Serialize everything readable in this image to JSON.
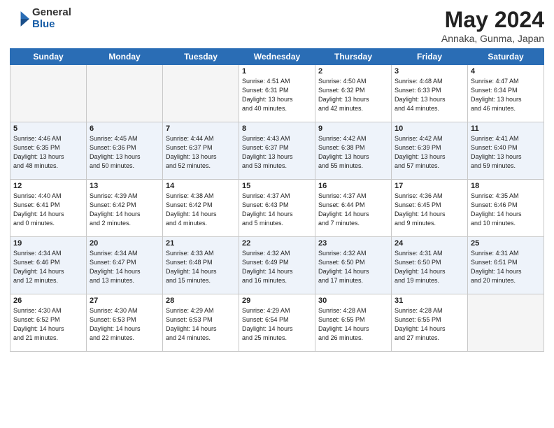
{
  "logo": {
    "general": "General",
    "blue": "Blue"
  },
  "title": {
    "month": "May 2024",
    "location": "Annaka, Gunma, Japan"
  },
  "weekdays": [
    "Sunday",
    "Monday",
    "Tuesday",
    "Wednesday",
    "Thursday",
    "Friday",
    "Saturday"
  ],
  "weeks": [
    [
      {
        "day": "",
        "info": ""
      },
      {
        "day": "",
        "info": ""
      },
      {
        "day": "",
        "info": ""
      },
      {
        "day": "1",
        "info": "Sunrise: 4:51 AM\nSunset: 6:31 PM\nDaylight: 13 hours\nand 40 minutes."
      },
      {
        "day": "2",
        "info": "Sunrise: 4:50 AM\nSunset: 6:32 PM\nDaylight: 13 hours\nand 42 minutes."
      },
      {
        "day": "3",
        "info": "Sunrise: 4:48 AM\nSunset: 6:33 PM\nDaylight: 13 hours\nand 44 minutes."
      },
      {
        "day": "4",
        "info": "Sunrise: 4:47 AM\nSunset: 6:34 PM\nDaylight: 13 hours\nand 46 minutes."
      }
    ],
    [
      {
        "day": "5",
        "info": "Sunrise: 4:46 AM\nSunset: 6:35 PM\nDaylight: 13 hours\nand 48 minutes."
      },
      {
        "day": "6",
        "info": "Sunrise: 4:45 AM\nSunset: 6:36 PM\nDaylight: 13 hours\nand 50 minutes."
      },
      {
        "day": "7",
        "info": "Sunrise: 4:44 AM\nSunset: 6:37 PM\nDaylight: 13 hours\nand 52 minutes."
      },
      {
        "day": "8",
        "info": "Sunrise: 4:43 AM\nSunset: 6:37 PM\nDaylight: 13 hours\nand 53 minutes."
      },
      {
        "day": "9",
        "info": "Sunrise: 4:42 AM\nSunset: 6:38 PM\nDaylight: 13 hours\nand 55 minutes."
      },
      {
        "day": "10",
        "info": "Sunrise: 4:42 AM\nSunset: 6:39 PM\nDaylight: 13 hours\nand 57 minutes."
      },
      {
        "day": "11",
        "info": "Sunrise: 4:41 AM\nSunset: 6:40 PM\nDaylight: 13 hours\nand 59 minutes."
      }
    ],
    [
      {
        "day": "12",
        "info": "Sunrise: 4:40 AM\nSunset: 6:41 PM\nDaylight: 14 hours\nand 0 minutes."
      },
      {
        "day": "13",
        "info": "Sunrise: 4:39 AM\nSunset: 6:42 PM\nDaylight: 14 hours\nand 2 minutes."
      },
      {
        "day": "14",
        "info": "Sunrise: 4:38 AM\nSunset: 6:42 PM\nDaylight: 14 hours\nand 4 minutes."
      },
      {
        "day": "15",
        "info": "Sunrise: 4:37 AM\nSunset: 6:43 PM\nDaylight: 14 hours\nand 5 minutes."
      },
      {
        "day": "16",
        "info": "Sunrise: 4:37 AM\nSunset: 6:44 PM\nDaylight: 14 hours\nand 7 minutes."
      },
      {
        "day": "17",
        "info": "Sunrise: 4:36 AM\nSunset: 6:45 PM\nDaylight: 14 hours\nand 9 minutes."
      },
      {
        "day": "18",
        "info": "Sunrise: 4:35 AM\nSunset: 6:46 PM\nDaylight: 14 hours\nand 10 minutes."
      }
    ],
    [
      {
        "day": "19",
        "info": "Sunrise: 4:34 AM\nSunset: 6:46 PM\nDaylight: 14 hours\nand 12 minutes."
      },
      {
        "day": "20",
        "info": "Sunrise: 4:34 AM\nSunset: 6:47 PM\nDaylight: 14 hours\nand 13 minutes."
      },
      {
        "day": "21",
        "info": "Sunrise: 4:33 AM\nSunset: 6:48 PM\nDaylight: 14 hours\nand 15 minutes."
      },
      {
        "day": "22",
        "info": "Sunrise: 4:32 AM\nSunset: 6:49 PM\nDaylight: 14 hours\nand 16 minutes."
      },
      {
        "day": "23",
        "info": "Sunrise: 4:32 AM\nSunset: 6:50 PM\nDaylight: 14 hours\nand 17 minutes."
      },
      {
        "day": "24",
        "info": "Sunrise: 4:31 AM\nSunset: 6:50 PM\nDaylight: 14 hours\nand 19 minutes."
      },
      {
        "day": "25",
        "info": "Sunrise: 4:31 AM\nSunset: 6:51 PM\nDaylight: 14 hours\nand 20 minutes."
      }
    ],
    [
      {
        "day": "26",
        "info": "Sunrise: 4:30 AM\nSunset: 6:52 PM\nDaylight: 14 hours\nand 21 minutes."
      },
      {
        "day": "27",
        "info": "Sunrise: 4:30 AM\nSunset: 6:53 PM\nDaylight: 14 hours\nand 22 minutes."
      },
      {
        "day": "28",
        "info": "Sunrise: 4:29 AM\nSunset: 6:53 PM\nDaylight: 14 hours\nand 24 minutes."
      },
      {
        "day": "29",
        "info": "Sunrise: 4:29 AM\nSunset: 6:54 PM\nDaylight: 14 hours\nand 25 minutes."
      },
      {
        "day": "30",
        "info": "Sunrise: 4:28 AM\nSunset: 6:55 PM\nDaylight: 14 hours\nand 26 minutes."
      },
      {
        "day": "31",
        "info": "Sunrise: 4:28 AM\nSunset: 6:55 PM\nDaylight: 14 hours\nand 27 minutes."
      },
      {
        "day": "",
        "info": ""
      }
    ]
  ]
}
